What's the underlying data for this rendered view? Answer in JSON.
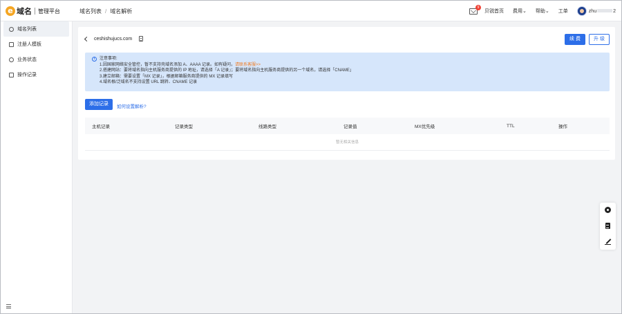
{
  "header": {
    "logo_letter": "e",
    "logo_name": "域名",
    "logo_sub": "管理平台",
    "breadcrumb": [
      "域名列表",
      "域名解析"
    ],
    "mail_badge": "9",
    "links": [
      "贝锐首页",
      "费用",
      "帮助",
      "工单"
    ],
    "username_start": "zhu",
    "username_end": "2"
  },
  "sidebar": {
    "items": [
      {
        "label": "域名列表",
        "icon": "globe-icon",
        "active": true
      },
      {
        "label": "注册人模板",
        "icon": "template-icon",
        "active": false
      },
      {
        "label": "业务状态",
        "icon": "status-icon",
        "active": false
      },
      {
        "label": "操作记录",
        "icon": "record-icon",
        "active": false
      }
    ]
  },
  "main": {
    "domain": "ceshishujucs.com",
    "renew_label": "续 费",
    "upgrade_label": "升 级",
    "notice": {
      "title": "注意事项:",
      "line1_text": "1.因国家网络安全管控，暂不支持壳域名添加 A、AAAA 记录。如有疑问，",
      "line1_link": "请联系客服>>",
      "line2": "2.搭建网站：要将域名指向主机服务商提供的 IP 地址，请选择「A 记录」；要将域名指向主机服务商提供的另一个域名，请选择「CNAME」",
      "line3": "3.建立邮箱：需要设置「MX 记录」，根据邮箱服务商提供的 MX 记录填写",
      "line4": "4.域名根/泛域名不支持设置 URL 跳转、CNAME 记录"
    },
    "add_record_label": "添加记录",
    "help_link": "如何设置解析?",
    "table": {
      "columns": [
        "主机记录",
        "记录类型",
        "线路类型",
        "记录值",
        "MX优先级",
        "TTL",
        "操作"
      ],
      "empty_text": "暂无相关信息"
    }
  },
  "colors": {
    "primary": "#2c6ee8",
    "notice_bg": "#d6e6fb",
    "link_orange": "#f07c24",
    "logo": "#f5a623"
  }
}
